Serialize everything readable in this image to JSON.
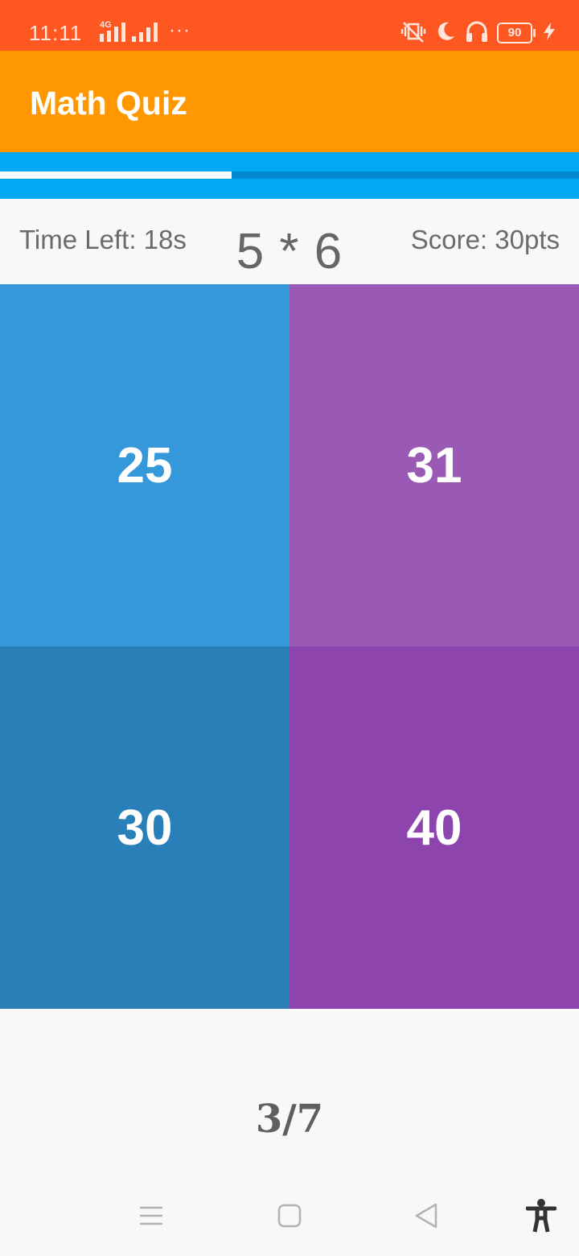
{
  "status_bar": {
    "time": "11:11",
    "network": "4G",
    "more": "···",
    "battery": "90",
    "icons": [
      "vibrate-icon",
      "moon-icon",
      "headphones-icon",
      "battery-icon",
      "charging-icon"
    ]
  },
  "app": {
    "title": "Math Quiz",
    "accent_color": "#ff9800",
    "status_color": "#ff5722"
  },
  "progress": {
    "fraction": 0.4
  },
  "quiz": {
    "time_left": "Time Left: 18s",
    "question": "5 * 6",
    "score": "Score: 30pts",
    "answers": [
      "25",
      "31",
      "30",
      "40"
    ],
    "answer_colors": [
      "#3498db",
      "#9b59b6",
      "#2980b9",
      "#8e44ad"
    ],
    "counter": "3/7"
  },
  "nav_bar": {
    "items": [
      "menu-icon",
      "home-icon",
      "back-icon",
      "accessibility-icon"
    ]
  }
}
